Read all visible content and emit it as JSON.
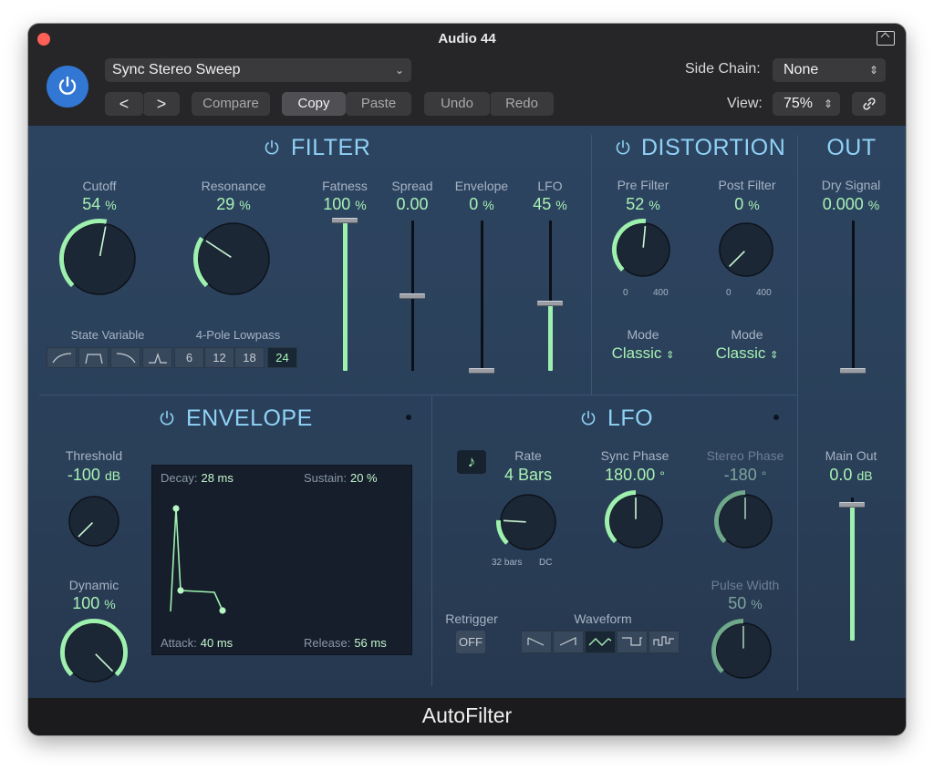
{
  "window": {
    "title": "Audio 44"
  },
  "toolbar": {
    "preset": "Sync Stereo Sweep",
    "prev": "<",
    "next": ">",
    "compare": "Compare",
    "copy": "Copy",
    "paste": "Paste",
    "undo": "Undo",
    "redo": "Redo",
    "side_chain_label": "Side Chain:",
    "side_chain_value": "None",
    "view_label": "View:",
    "view_value": "75%",
    "link_icon": "link-icon",
    "power_icon": "power-icon"
  },
  "filter": {
    "title": "FILTER",
    "cutoff": {
      "label": "Cutoff",
      "value": "54",
      "unit": "%",
      "amount": 0.54
    },
    "resonance": {
      "label": "Resonance",
      "value": "29",
      "unit": "%",
      "amount": 0.29
    },
    "fatness": {
      "label": "Fatness",
      "value": "100",
      "unit": "%",
      "amount": 1.0
    },
    "spread": {
      "label": "Spread",
      "value": "0.00",
      "amount": 0.5
    },
    "envelope": {
      "label": "Envelope",
      "value": "0",
      "unit": "%",
      "amount": 0.0
    },
    "lfo": {
      "label": "LFO",
      "value": "45",
      "unit": "%",
      "amount": 0.45
    },
    "state_variable_label": "State Variable",
    "lowpass_label": "4-Pole Lowpass",
    "slopes": [
      "6",
      "12",
      "18",
      "24"
    ],
    "selected_slope": "24"
  },
  "distortion": {
    "title": "DISTORTION",
    "pre_filter": {
      "label": "Pre Filter",
      "value": "52",
      "unit": "%",
      "amount": 0.52,
      "min": "0",
      "max": "400"
    },
    "post_filter": {
      "label": "Post Filter",
      "value": "0",
      "unit": "%",
      "amount": 0.0,
      "min": "0",
      "max": "400"
    },
    "mode_label": "Mode",
    "pre_mode": "Classic",
    "post_mode": "Classic"
  },
  "out": {
    "title": "OUT",
    "dry_signal": {
      "label": "Dry Signal",
      "value": "0.000",
      "unit": "%",
      "amount": 0.0
    },
    "main_out": {
      "label": "Main Out",
      "value": "0.0",
      "unit": "dB",
      "amount": 0.95
    }
  },
  "envelope": {
    "title": "ENVELOPE",
    "threshold": {
      "label": "Threshold",
      "value": "-100",
      "unit": "dB",
      "amount": 0.0
    },
    "dynamic": {
      "label": "Dynamic",
      "value": "100",
      "unit": "%",
      "amount": 1.0
    },
    "decay": {
      "label": "Decay:",
      "value": "28 ms"
    },
    "sustain": {
      "label": "Sustain:",
      "value": "20 %"
    },
    "attack": {
      "label": "Attack:",
      "value": "40 ms"
    },
    "release": {
      "label": "Release:",
      "value": "56 ms"
    }
  },
  "lfo": {
    "title": "LFO",
    "rate": {
      "label": "Rate",
      "value": "4 Bars",
      "min": "32 bars",
      "max": "DC",
      "amount": 0.18
    },
    "sync_phase": {
      "label": "Sync Phase",
      "value": "180.00",
      "unit": "°",
      "amount": 0.5
    },
    "stereo_phase": {
      "label": "Stereo Phase",
      "value": "-180",
      "unit": "°",
      "amount": 0.5
    },
    "pulse_width": {
      "label": "Pulse Width",
      "value": "50",
      "unit": "%",
      "amount": 0.5
    },
    "retrigger_label": "Retrigger",
    "retrigger_value": "OFF",
    "waveform_label": "Waveform",
    "waveforms": [
      "ramp-down",
      "ramp-up",
      "triangle",
      "square",
      "random"
    ],
    "selected_waveform": "triangle"
  },
  "footer": {
    "title": "AutoFilter"
  },
  "colors": {
    "accent": "#a8f2b4",
    "title": "#8fd2f6",
    "panel": "#2b425d",
    "power": "#3177d3"
  }
}
